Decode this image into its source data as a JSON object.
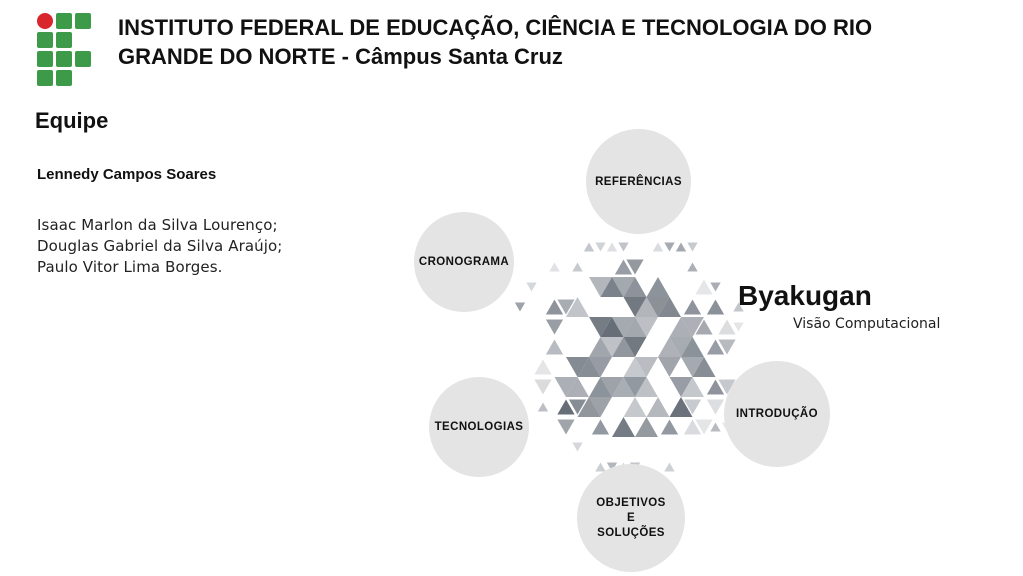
{
  "header": {
    "title": "INSTITUTO FEDERAL DE EDUCAÇÃO, CIÊNCIA E TECNOLOGIA DO RIO GRANDE DO NORTE - Câmpus Santa Cruz"
  },
  "team": {
    "heading": "Equipe",
    "lead": "Lennedy Campos Soares",
    "members": [
      "Isaac Marlon da Silva Lourenço;",
      "Douglas Gabriel da Silva Araújo;",
      "Paulo Vitor Lima Borges."
    ]
  },
  "project": {
    "title": "Byakugan",
    "subtitle": "Visão Computacional"
  },
  "nav": {
    "referencias": "REFERÊNCIAS",
    "cronograma": "CRONOGRAMA",
    "introducao": "INTRODUÇÃO",
    "tecnologias": "TECNOLOGIAS",
    "objetivos": [
      "OBJETIVOS",
      "E",
      "SOLUÇÕES"
    ]
  },
  "colors": {
    "logo_green": "#3d9a48",
    "logo_red": "#d8262c",
    "node_fill": "#e4e4e4"
  }
}
